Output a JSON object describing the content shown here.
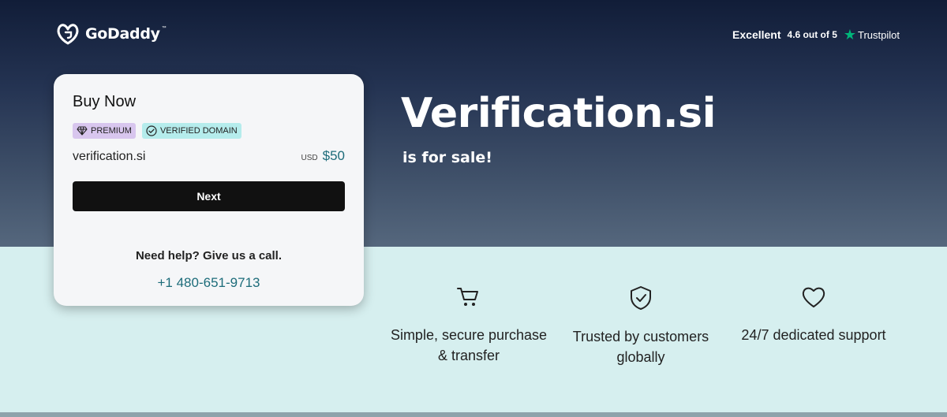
{
  "header": {
    "logo_text": "GoDaddy",
    "logo_tm": "™",
    "trust_excellent": "Excellent",
    "trust_rating": "4.6 out of 5",
    "trust_brand": "Trustpilot",
    "trust_star_color": "#00b67a"
  },
  "card": {
    "title": "Buy Now",
    "badge_premium": "PREMIUM",
    "badge_verified": "VERIFIED DOMAIN",
    "domain": "verification.si",
    "currency": "USD",
    "price": "$50",
    "next_label": "Next",
    "help_text": "Need help? Give us a call.",
    "phone": "+1 480-651-9713"
  },
  "hero": {
    "headline": "Verification.si",
    "subhead": "is for sale!"
  },
  "features": [
    {
      "icon": "cart-icon",
      "text": "Simple, secure purchase & transfer"
    },
    {
      "icon": "shield-check-icon",
      "text": "Trusted by customers globally"
    },
    {
      "icon": "heart-icon",
      "text": "24/7 dedicated support"
    }
  ],
  "colors": {
    "accent": "#1d6c7a",
    "button": "#111111",
    "premium_badge": "#d8c6ee",
    "verified_badge": "#b5ecec",
    "lower_background": "#d6efef"
  }
}
